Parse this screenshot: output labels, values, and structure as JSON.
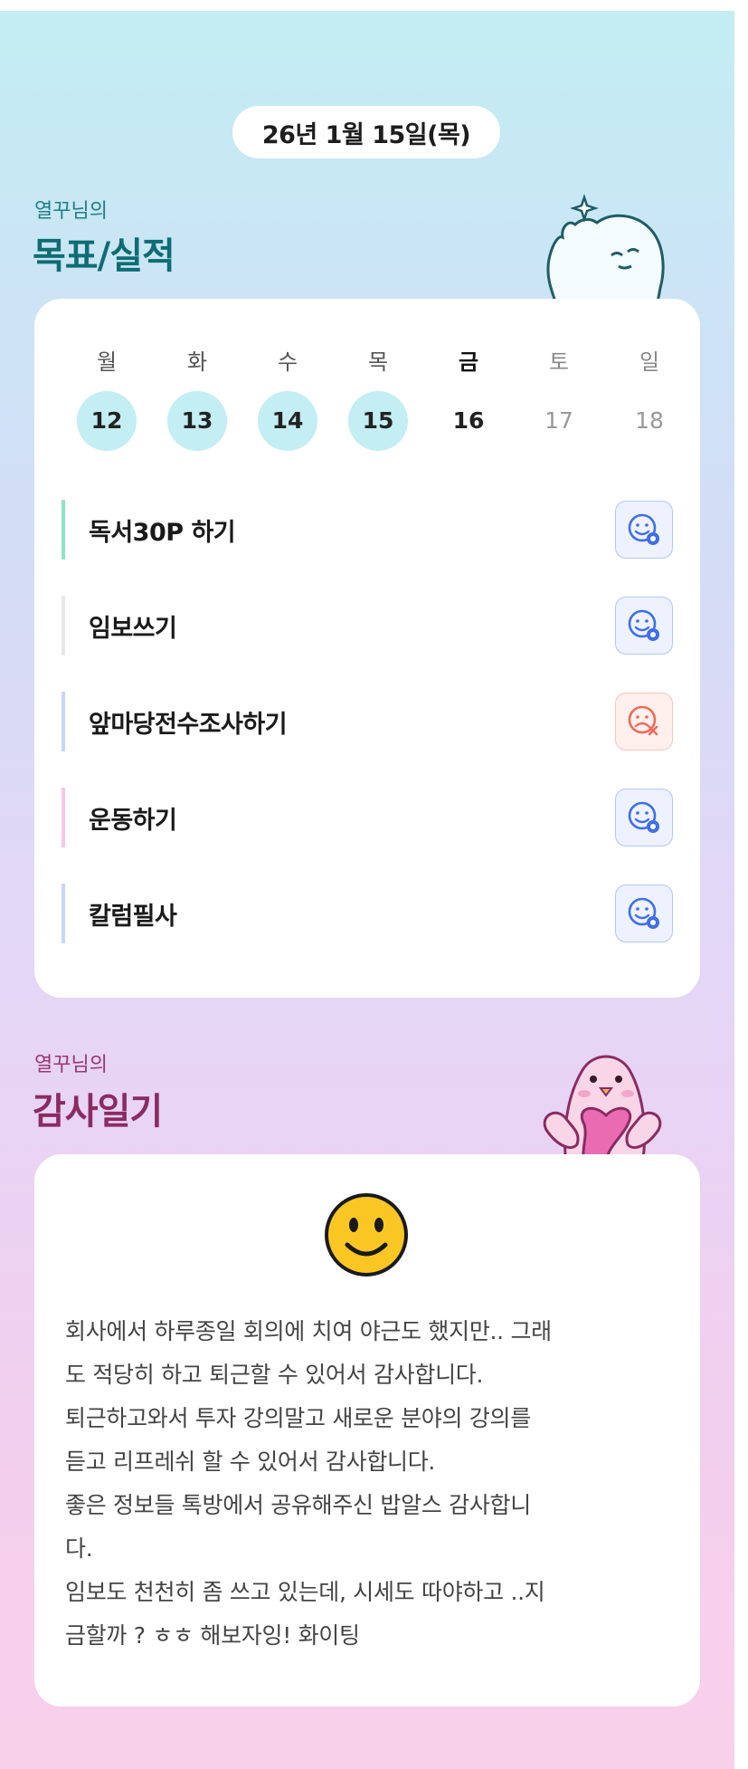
{
  "header": {
    "date": "26년 1월 15일(목)"
  },
  "goals_section": {
    "subtitle": "열꾸님의",
    "title": "목표/실적",
    "week": [
      {
        "name": "월",
        "num": "12",
        "state": "done"
      },
      {
        "name": "화",
        "num": "13",
        "state": "done"
      },
      {
        "name": "수",
        "num": "14",
        "state": "done"
      },
      {
        "name": "목",
        "num": "15",
        "state": "done"
      },
      {
        "name": "금",
        "num": "16",
        "state": "today"
      },
      {
        "name": "토",
        "num": "17",
        "state": "future"
      },
      {
        "name": "일",
        "num": "18",
        "state": "future"
      }
    ],
    "items": [
      {
        "label": "독서30P 하기",
        "bar_color": "#8fe3c8",
        "status": "achieved",
        "icon": "smile-check-icon"
      },
      {
        "label": "임보쓰기",
        "bar_color": "#e8e8e8",
        "status": "achieved",
        "icon": "smile-check-icon"
      },
      {
        "label": "앞마당전수조사하기",
        "bar_color": "#c9d6fb",
        "status": "failed",
        "icon": "sad-x-icon"
      },
      {
        "label": "운동하기",
        "bar_color": "#f8c6e6",
        "status": "achieved",
        "icon": "smile-check-icon"
      },
      {
        "label": "칼럼필사",
        "bar_color": "#c9d6fb",
        "status": "achieved",
        "icon": "smile-check-icon"
      }
    ]
  },
  "thanks_section": {
    "subtitle": "열꾸님의",
    "title": "감사일기",
    "mood_icon": "smiling-face-icon",
    "text": "회사에서 하루종일 회의에 치여 야근도 했지만.. 그래\n도 적당히 하고 퇴근할 수 있어서 감사합니다.\n퇴근하고와서 투자 강의말고 새로운 분야의 강의를\n듣고 리프레쉬 할 수 있어서 감사합니다.\n좋은 정보들 톡방에서 공유해주신 밥알스 감사합니\n다.\n임보도 천천히 좀 쓰고 있는데, 시세도 따야하고 ..지\n금할까 ? ㅎㅎ 해보자잉! 화이팅"
  },
  "colors": {
    "achieved_icon": "#3f6ee8",
    "achieved_bg": "#eef2ff",
    "failed_icon": "#ef6a5a",
    "failed_bg": "#fff0ee",
    "done_day_bg": "#c3eef3"
  }
}
